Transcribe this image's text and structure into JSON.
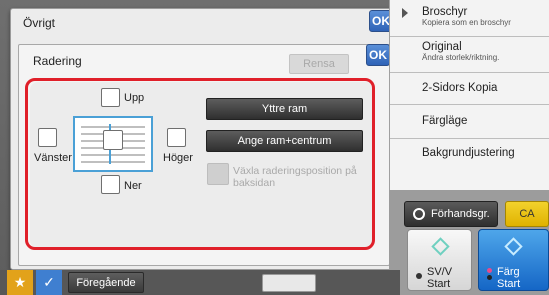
{
  "outer_dialog": {
    "title": "Övrigt",
    "ok_label": "OK"
  },
  "inner_dialog": {
    "title": "Radering",
    "ok_label": "OK",
    "clear_label": "Rensa"
  },
  "erase": {
    "top_label": "Upp",
    "left_label": "Vänster",
    "right_label": "Höger",
    "bottom_label": "Ner",
    "outer_frame_label": "Yttre ram",
    "frame_center_label": "Ange ram+centrum",
    "toggle_back_label_line1": "Växla raderingsposition på",
    "toggle_back_label_line2": "baksidan"
  },
  "right_menu": {
    "items": [
      {
        "label": "Broschyr",
        "sub": "Kopiera som en broschyr"
      },
      {
        "label": "Original",
        "sub": "Ändra storlek/riktning."
      },
      {
        "label": "2-Sidors Kopia",
        "sub": ""
      },
      {
        "label": "Färgläge",
        "sub": ""
      },
      {
        "label": "Bakgrundjustering",
        "sub": ""
      }
    ]
  },
  "actions": {
    "preview_label": "Förhandsgr.",
    "ca_label": "CA",
    "bw_start_line1": "SV/V",
    "bw_start_line2": "Start",
    "color_start_line1": "Färg",
    "color_start_line2": "Start"
  },
  "bottom": {
    "previous_label": "Föregående"
  },
  "colors": {
    "accent_red": "#e0202a",
    "ok_blue": "#2f63b7",
    "start_blue": "#1566c6",
    "ca_yellow": "#e0b200"
  }
}
